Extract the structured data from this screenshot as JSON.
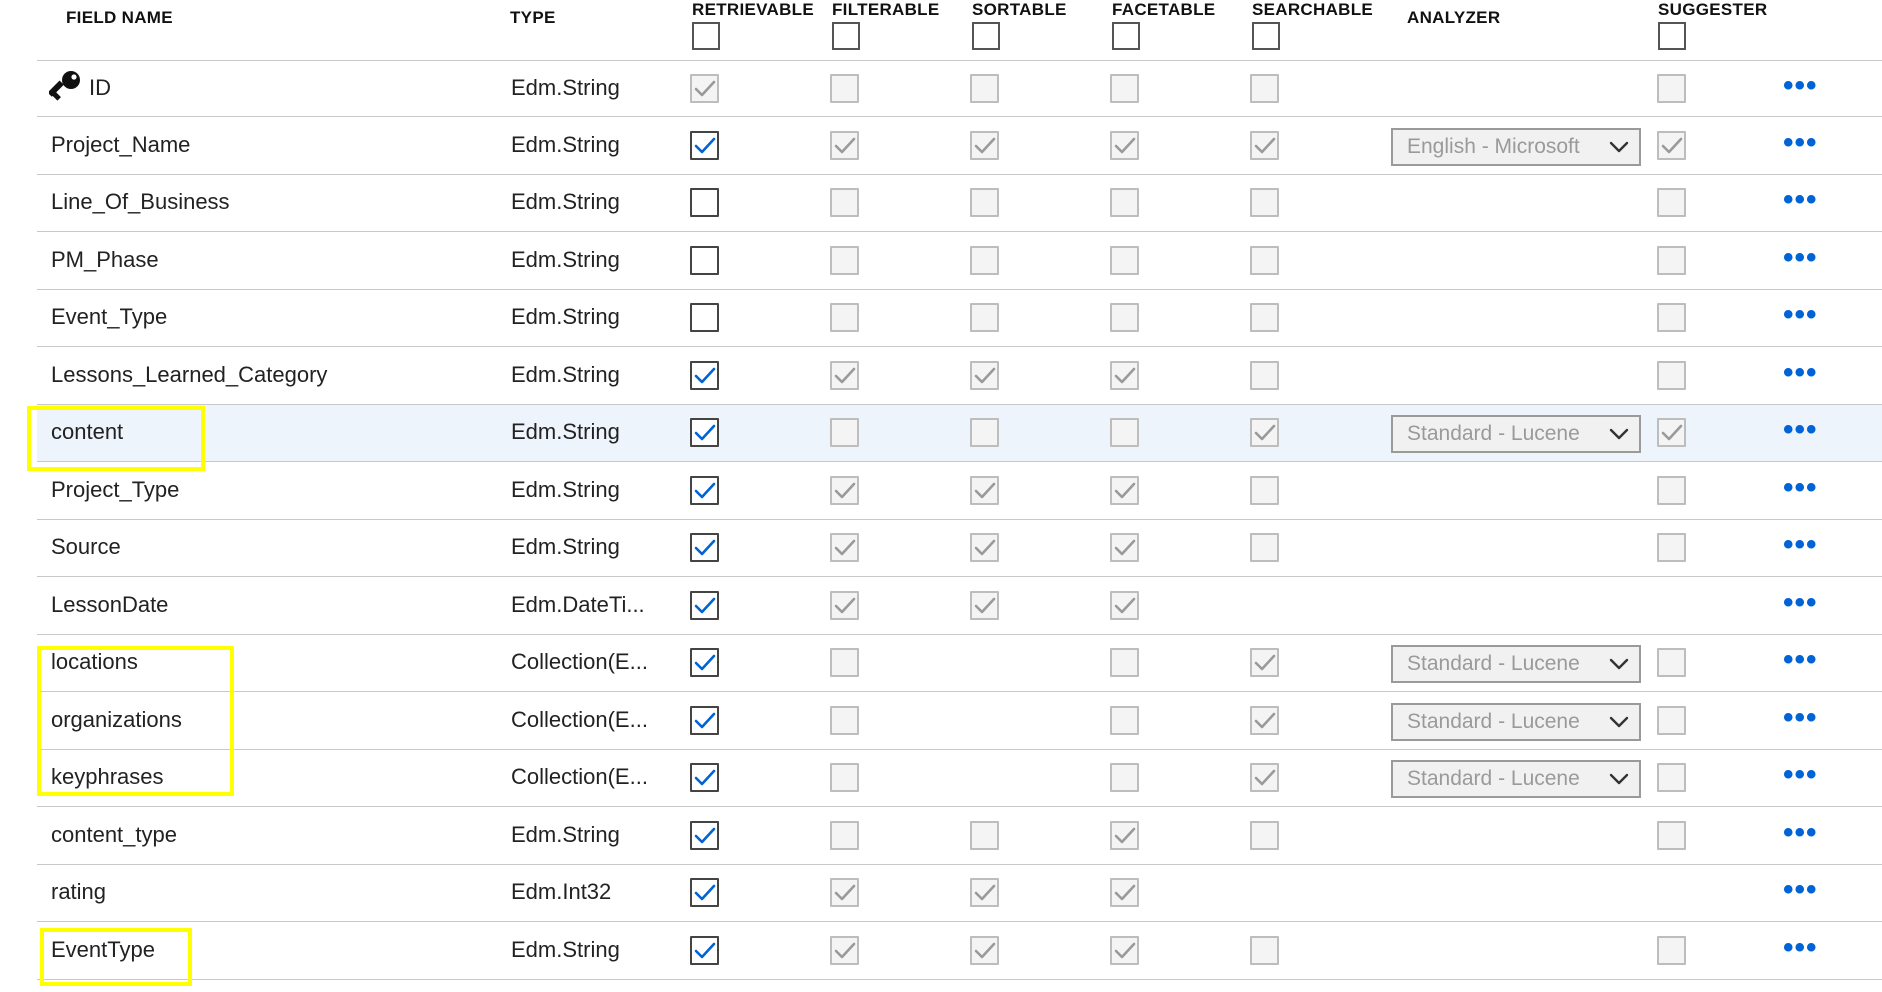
{
  "headers": {
    "field_name": "FIELD NAME",
    "type": "TYPE",
    "retrievable": "RETRIEVABLE",
    "filterable": "FILTERABLE",
    "sortable": "SORTABLE",
    "facetable": "FACETABLE",
    "searchable": "SEARCHABLE",
    "analyzer": "ANALYZER",
    "suggester": "SUGGESTER"
  },
  "icons": {
    "key": "key-icon",
    "more": "more-icon",
    "chevron": "chevron-down-icon",
    "check": "check-icon"
  },
  "colors": {
    "check_enabled": "#0063d6",
    "check_disabled": "#9a9a9a",
    "more": "#0063d6",
    "highlight": "#ffff00",
    "selected_row": "#eef4fc"
  },
  "rows": [
    {
      "name": "ID",
      "type": "Edm.String",
      "key": true,
      "ret": "d1",
      "fil": "d0",
      "sor": "d0",
      "fac": "d0",
      "sea": "d0",
      "analyzer": "",
      "sug": "d0"
    },
    {
      "name": "Project_Name",
      "type": "Edm.String",
      "ret": "e1",
      "fil": "d1",
      "sor": "d1",
      "fac": "d1",
      "sea": "d1",
      "analyzer": "English - Microsoft",
      "sug": "d1"
    },
    {
      "name": "Line_Of_Business",
      "type": "Edm.String",
      "ret": "e0",
      "fil": "d0",
      "sor": "d0",
      "fac": "d0",
      "sea": "d0",
      "analyzer": "",
      "sug": "d0"
    },
    {
      "name": "PM_Phase",
      "type": "Edm.String",
      "ret": "e0",
      "fil": "d0",
      "sor": "d0",
      "fac": "d0",
      "sea": "d0",
      "analyzer": "",
      "sug": "d0"
    },
    {
      "name": "Event_Type",
      "type": "Edm.String",
      "ret": "e0",
      "fil": "d0",
      "sor": "d0",
      "fac": "d0",
      "sea": "d0",
      "analyzer": "",
      "sug": "d0"
    },
    {
      "name": "Lessons_Learned_Category",
      "type": "Edm.String",
      "ret": "e1",
      "fil": "d1",
      "sor": "d1",
      "fac": "d1",
      "sea": "d0",
      "analyzer": "",
      "sug": "d0"
    },
    {
      "name": "content",
      "type": "Edm.String",
      "selected": true,
      "ret": "e1",
      "fil": "d0",
      "sor": "d0",
      "fac": "d0",
      "sea": "d1",
      "analyzer": "Standard - Lucene",
      "sug": "d1"
    },
    {
      "name": "Project_Type",
      "type": "Edm.String",
      "ret": "e1",
      "fil": "d1",
      "sor": "d1",
      "fac": "d1",
      "sea": "d0",
      "analyzer": "",
      "sug": "d0"
    },
    {
      "name": "Source",
      "type": "Edm.String",
      "ret": "e1",
      "fil": "d1",
      "sor": "d1",
      "fac": "d1",
      "sea": "d0",
      "analyzer": "",
      "sug": "d0"
    },
    {
      "name": "LessonDate",
      "type": "Edm.DateTi...",
      "ret": "e1",
      "fil": "d1",
      "sor": "d1",
      "fac": "d1",
      "sea": "none",
      "analyzer": "",
      "sug": "none"
    },
    {
      "name": "locations",
      "type": "Collection(E...",
      "ret": "e1",
      "fil": "d0",
      "sor": "none",
      "fac": "d0",
      "sea": "d1",
      "analyzer": "Standard - Lucene",
      "sug": "d0"
    },
    {
      "name": "organizations",
      "type": "Collection(E...",
      "ret": "e1",
      "fil": "d0",
      "sor": "none",
      "fac": "d0",
      "sea": "d1",
      "analyzer": "Standard - Lucene",
      "sug": "d0"
    },
    {
      "name": "keyphrases",
      "type": "Collection(E...",
      "ret": "e1",
      "fil": "d0",
      "sor": "none",
      "fac": "d0",
      "sea": "d1",
      "analyzer": "Standard - Lucene",
      "sug": "d0"
    },
    {
      "name": "content_type",
      "type": "Edm.String",
      "ret": "e1",
      "fil": "d0",
      "sor": "d0",
      "fac": "d1",
      "sea": "d0",
      "analyzer": "",
      "sug": "d0"
    },
    {
      "name": "rating",
      "type": "Edm.Int32",
      "ret": "e1",
      "fil": "d1",
      "sor": "d1",
      "fac": "d1",
      "sea": "none",
      "analyzer": "",
      "sug": "none"
    },
    {
      "name": "EventType",
      "type": "Edm.String",
      "ret": "e1",
      "fil": "d1",
      "sor": "d1",
      "fac": "d1",
      "sea": "d0",
      "analyzer": "",
      "sug": "d0"
    }
  ]
}
